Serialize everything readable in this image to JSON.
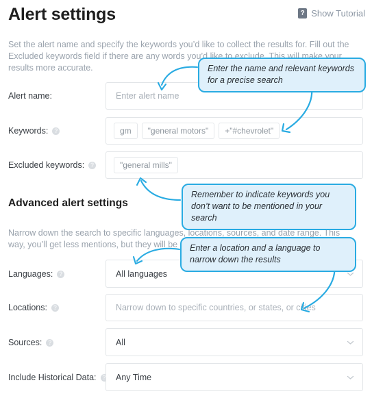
{
  "header": {
    "title": "Alert settings",
    "tutorial_label": "Show Tutorial",
    "tutorial_icon": "question-mark-icon",
    "tutorial_icon_glyph": "?"
  },
  "descriptions": {
    "top": "Set the alert name and specify the keywords you’d like to collect the results for. Fill out the Excluded keywords field if there are any words you’d like to exclude. This will make your results more accurate.",
    "advanced": "Narrow down the search to specific languages, locations, sources, and date range. This way, you’ll get less mentions, but they will be more accurate."
  },
  "sections": {
    "advanced_heading": "Advanced alert settings"
  },
  "fields": {
    "alert_name": {
      "label": "Alert name:",
      "placeholder": "Enter alert name",
      "value": "",
      "has_help": false
    },
    "keywords": {
      "label": "Keywords:",
      "has_help": true,
      "tags": [
        "gm",
        "\"general motors\"",
        "+\"#chevrolet\""
      ]
    },
    "excluded_keywords": {
      "label": "Excluded keywords:",
      "has_help": true,
      "tags": [
        "\"general mills\""
      ]
    },
    "languages": {
      "label": "Languages:",
      "has_help": true,
      "value": "All languages",
      "options": [
        "All languages"
      ]
    },
    "locations": {
      "label": "Locations:",
      "has_help": true,
      "placeholder": "Narrow down to specific countries, or states, or cities",
      "value": ""
    },
    "sources": {
      "label": "Sources:",
      "has_help": true,
      "value": "All",
      "options": [
        "All"
      ]
    },
    "historical_data": {
      "label": "Include Historical Data:",
      "has_help": true,
      "value": "Any Time",
      "options": [
        "Any Time"
      ]
    }
  },
  "callouts": {
    "one": "Enter the name and relevant keywords for a precise search",
    "two": "Remember to indicate keywords you don’t want to be mentioned in your search",
    "three": "Enter a location and a language to narrow down the results"
  },
  "colors": {
    "accent": "#29abe2",
    "callout_bg": "#dff0fb",
    "text": "#3a3f45",
    "muted": "#9aa3ad",
    "border": "#e2e5e8"
  },
  "help_icon_glyph": "?"
}
